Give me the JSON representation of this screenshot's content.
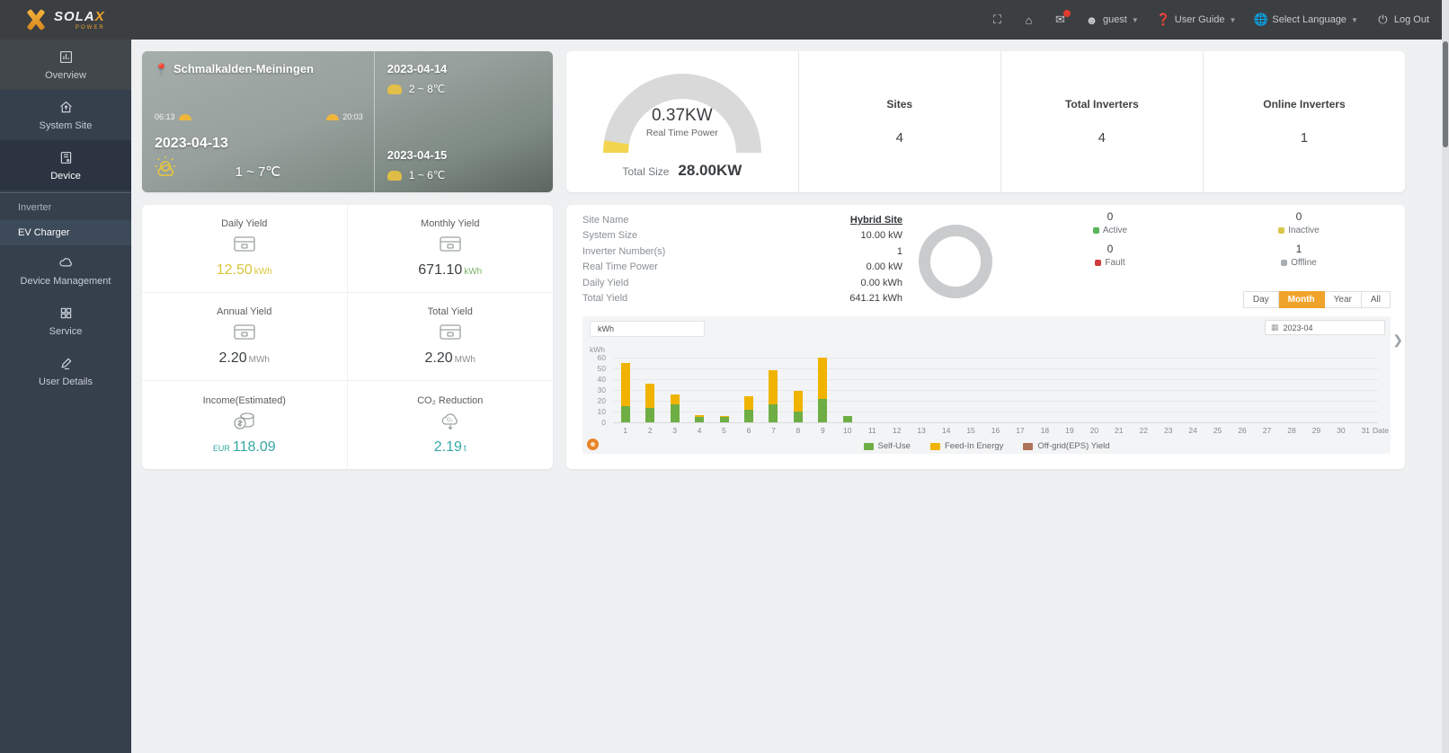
{
  "topbar": {
    "logo": "SOLA",
    "logo_x": "X",
    "logo_sub": "POWER",
    "user": "guest",
    "user_guide": "User Guide",
    "language": "Select Language",
    "logout": "Log Out"
  },
  "sidebar": {
    "items": [
      {
        "label": "Overview"
      },
      {
        "label": "System Site"
      },
      {
        "label": "Device"
      },
      {
        "label": "Device Management"
      },
      {
        "label": "Service"
      },
      {
        "label": "User Details"
      }
    ],
    "device_submenu": [
      {
        "label": "Inverter"
      },
      {
        "label": "EV Charger"
      }
    ]
  },
  "weather": {
    "location": "Schmalkalden-Meiningen",
    "sunrise": "06:13",
    "sunset": "20:03",
    "today_date": "2023-04-13",
    "today_temp": "1 ~ 7℃",
    "forecast": [
      {
        "date": "2023-04-14",
        "temp": "2 ~ 8℃"
      },
      {
        "date": "2023-04-15",
        "temp": "1 ~ 6℃"
      }
    ]
  },
  "power_card": {
    "real_time_power": "0.37KW",
    "real_time_label": "Real Time Power",
    "total_size_label": "Total Size",
    "total_size": "28.00KW",
    "stats": [
      {
        "label": "Sites",
        "value": "4"
      },
      {
        "label": "Total Inverters",
        "value": "4"
      },
      {
        "label": "Online Inverters",
        "value": "1"
      }
    ]
  },
  "yield_card": {
    "items": [
      {
        "label": "Daily Yield",
        "value": "12.50",
        "unit": "kWh",
        "prefix": ""
      },
      {
        "label": "Monthly Yield",
        "value": "671.10",
        "unit": "kWh",
        "prefix": ""
      },
      {
        "label": "Annual Yield",
        "value": "2.20",
        "unit": "MWh",
        "prefix": ""
      },
      {
        "label": "Total Yield",
        "value": "2.20",
        "unit": "MWh",
        "prefix": ""
      },
      {
        "label": "Income(Estimated)",
        "value": "118.09",
        "unit": "",
        "prefix": "EUR"
      },
      {
        "label": "CO₂ Reduction",
        "value": "2.19",
        "unit": "t",
        "prefix": ""
      }
    ]
  },
  "site_card": {
    "details": [
      {
        "label": "Site Name",
        "value": "Hybrid Site"
      },
      {
        "label": "System Size",
        "value": "10.00 kW"
      },
      {
        "label": "Inverter Number(s)",
        "value": "1"
      },
      {
        "label": "Real Time Power",
        "value": "0.00 kW"
      },
      {
        "label": "Daily Yield",
        "value": "0.00 kWh"
      },
      {
        "label": "Total Yield",
        "value": "641.21 kWh"
      }
    ],
    "statuses": [
      {
        "label": "Active",
        "value": "0",
        "color": "#58b55c"
      },
      {
        "label": "Inactive",
        "value": "0",
        "color": "#d9c54a"
      },
      {
        "label": "Fault",
        "value": "0",
        "color": "#d23b3b"
      },
      {
        "label": "Offline",
        "value": "1",
        "color": "#a8adb2"
      }
    ],
    "range_tabs": [
      "Day",
      "Month",
      "Year",
      "All"
    ],
    "active_tab": "Month",
    "date_value": "2023-04",
    "unit_select": "kWh"
  },
  "chart_data": {
    "type": "bar",
    "stacked": true,
    "title": "",
    "xlabel": "Date",
    "ylabel": "kWh",
    "ylim": [
      0,
      60
    ],
    "yticks": [
      0,
      10,
      20,
      30,
      40,
      50,
      60
    ],
    "grid": true,
    "legend_position": "bottom",
    "categories": [
      "1",
      "2",
      "3",
      "4",
      "5",
      "6",
      "7",
      "8",
      "9",
      "10",
      "11",
      "12",
      "13",
      "14",
      "15",
      "16",
      "17",
      "18",
      "19",
      "20",
      "21",
      "22",
      "23",
      "24",
      "25",
      "26",
      "27",
      "28",
      "29",
      "30",
      "31"
    ],
    "series": [
      {
        "name": "Self-Use",
        "color": "#6fae44",
        "values": [
          15,
          13,
          17,
          5,
          5,
          12,
          17,
          10,
          22,
          6,
          0,
          0,
          0,
          0,
          0,
          0,
          0,
          0,
          0,
          0,
          0,
          0,
          0,
          0,
          0,
          0,
          0,
          0,
          0,
          0,
          0
        ]
      },
      {
        "name": "Feed-In Energy",
        "color": "#f0b400",
        "values": [
          40,
          23,
          9,
          2,
          1,
          12,
          31,
          19,
          38,
          0,
          0,
          0,
          0,
          0,
          0,
          0,
          0,
          0,
          0,
          0,
          0,
          0,
          0,
          0,
          0,
          0,
          0,
          0,
          0,
          0,
          0
        ]
      },
      {
        "name": "Off-grid(EPS) Yield",
        "color": "#ad7259",
        "values": [
          0,
          0,
          0,
          0,
          0,
          0,
          0,
          0,
          0,
          0,
          0,
          0,
          0,
          0,
          0,
          0,
          0,
          0,
          0,
          0,
          0,
          0,
          0,
          0,
          0,
          0,
          0,
          0,
          0,
          0,
          0
        ]
      }
    ]
  },
  "colors": {
    "accent_orange": "#f0a32b",
    "teal_value": "#35a7a3",
    "daily_yellow": "#d9c53a",
    "green_unit": "#7cb36a"
  }
}
